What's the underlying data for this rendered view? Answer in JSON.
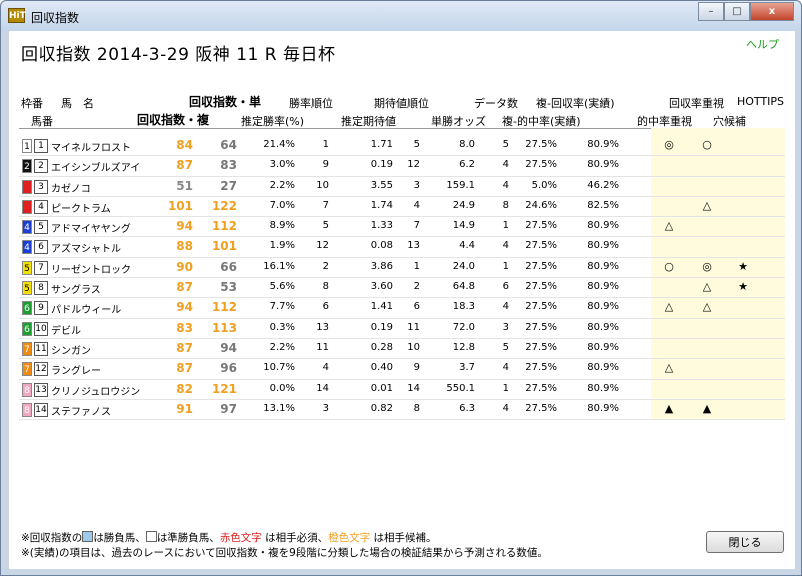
{
  "window": {
    "title": "回収指数",
    "app_icon_text": "HiT",
    "minimize": "–",
    "maximize": "□",
    "close": "x"
  },
  "page": {
    "help": "ヘルプ",
    "title": "回収指数  2014-3-29 阪神 11 R 毎日杯"
  },
  "headers": {
    "waku": "枠番",
    "uma": "馬　名",
    "umaban": "馬番",
    "index_single": "回収指数・単",
    "index_double": "回収指数・複",
    "win_rank": "勝率順位",
    "ev_rank": "期待値順位",
    "data_count": "データ数",
    "place_return": "複-回収率(実績)",
    "focus": "回収率重視",
    "hottips": "HOTTIPS",
    "est_win": "推定勝率(%)",
    "est_ev": "推定期待値",
    "win_odds": "単勝オッズ",
    "place_hit": "複-的中率(実績)",
    "hit_focus": "的中率重視",
    "dark_horse": "穴候補"
  },
  "colors": {
    "red": "#e02020",
    "orange": "#f0a020",
    "blue_cell": "#9fc9e8"
  },
  "rows": [
    {
      "waku": "1",
      "waku_bg": "#ffffff",
      "waku_fg": "#000",
      "uma": "1",
      "name": "マイネルフロスト",
      "i1": "84",
      "i1c": "#f0a020",
      "i2": "64",
      "wp": "21.4%",
      "wr": "1",
      "ev": "1.71",
      "er": "5",
      "odds": "8.0",
      "dc": "5",
      "hit": "27.5%",
      "ret": "80.9%",
      "m1": "◎",
      "m2": "○",
      "m3": ""
    },
    {
      "waku": "2",
      "waku_bg": "#111111",
      "waku_fg": "#fff",
      "uma": "2",
      "name": "エイシンブルズアイ",
      "i1": "87",
      "i1c": "#f0a020",
      "i2": "83",
      "wp": "3.0%",
      "wr": "9",
      "ev": "0.19",
      "er": "12",
      "odds": "6.2",
      "dc": "4",
      "hit": "27.5%",
      "ret": "80.9%",
      "m1": "",
      "m2": "",
      "m3": ""
    },
    {
      "waku": "3",
      "waku_bg": "#e02020",
      "waku_fg": "#e02020",
      "uma": "3",
      "name": "カゼノコ",
      "i1": "51",
      "i1c": "#888888",
      "i2": "27",
      "wp": "2.2%",
      "wr": "10",
      "ev": "3.55",
      "er": "3",
      "odds": "159.1",
      "dc": "4",
      "hit": "5.0%",
      "ret": "46.2%",
      "m1": "",
      "m2": "",
      "m3": ""
    },
    {
      "waku": "3",
      "waku_bg": "#e02020",
      "waku_fg": "#e02020",
      "uma": "4",
      "name": "ピークトラム",
      "i1": "101",
      "i1c": "#f0a020",
      "i2": "122",
      "i2c": "#f0a020",
      "wp": "7.0%",
      "wr": "7",
      "ev": "1.74",
      "er": "4",
      "odds": "24.9",
      "dc": "8",
      "hit": "24.6%",
      "ret": "82.5%",
      "m1": "",
      "m2": "△",
      "m3": ""
    },
    {
      "waku": "4",
      "waku_bg": "#1b3fd6",
      "waku_fg": "#fff",
      "uma": "5",
      "name": "アドマイヤヤング",
      "i1": "94",
      "i1c": "#f0a020",
      "i2": "112",
      "i2c": "#f0a020",
      "wp": "8.9%",
      "wr": "5",
      "ev": "1.33",
      "er": "7",
      "odds": "14.9",
      "dc": "1",
      "hit": "27.5%",
      "ret": "80.9%",
      "m1": "△",
      "m2": "",
      "m3": ""
    },
    {
      "waku": "4",
      "waku_bg": "#1b3fd6",
      "waku_fg": "#fff",
      "uma": "6",
      "name": "アズマシャトル",
      "i1": "88",
      "i1c": "#f0a020",
      "i2": "101",
      "i2c": "#f0a020",
      "wp": "1.9%",
      "wr": "12",
      "ev": "0.08",
      "er": "13",
      "odds": "4.4",
      "dc": "4",
      "hit": "27.5%",
      "ret": "80.9%",
      "m1": "",
      "m2": "",
      "m3": ""
    },
    {
      "waku": "5",
      "waku_bg": "#f4e000",
      "waku_fg": "#000",
      "uma": "7",
      "name": "リーゼントロック",
      "i1": "90",
      "i1c": "#f0a020",
      "i2": "66",
      "wp": "16.1%",
      "wr": "2",
      "ev": "3.86",
      "er": "1",
      "odds": "24.0",
      "dc": "1",
      "hit": "27.5%",
      "ret": "80.9%",
      "m1": "○",
      "m2": "◎",
      "m3": "★"
    },
    {
      "waku": "5",
      "waku_bg": "#f4e000",
      "waku_fg": "#000",
      "uma": "8",
      "name": "サングラス",
      "i1": "87",
      "i1c": "#f0a020",
      "i2": "53",
      "wp": "5.6%",
      "wr": "8",
      "ev": "3.60",
      "er": "2",
      "odds": "64.8",
      "dc": "6",
      "hit": "27.5%",
      "ret": "80.9%",
      "m1": "",
      "m2": "△",
      "m3": "★"
    },
    {
      "waku": "6",
      "waku_bg": "#1aa030",
      "waku_fg": "#fff",
      "uma": "9",
      "name": "パドルウィール",
      "i1": "94",
      "i1c": "#f0a020",
      "i2": "112",
      "i2c": "#f0a020",
      "wp": "7.7%",
      "wr": "6",
      "ev": "1.41",
      "er": "6",
      "odds": "18.3",
      "dc": "4",
      "hit": "27.5%",
      "ret": "80.9%",
      "m1": "△",
      "m2": "△",
      "m3": ""
    },
    {
      "waku": "6",
      "waku_bg": "#1aa030",
      "waku_fg": "#fff",
      "uma": "10",
      "name": "デビル",
      "i1": "83",
      "i1c": "#f0a020",
      "i2": "113",
      "i2c": "#f0a020",
      "wp": "0.3%",
      "wr": "13",
      "ev": "0.19",
      "er": "11",
      "odds": "72.0",
      "dc": "3",
      "hit": "27.5%",
      "ret": "80.9%",
      "m1": "",
      "m2": "",
      "m3": ""
    },
    {
      "waku": "7",
      "waku_bg": "#f08a10",
      "waku_fg": "#fff",
      "uma": "11",
      "name": "シンガン",
      "i1": "87",
      "i1c": "#f0a020",
      "i2": "94",
      "wp": "2.2%",
      "wr": "11",
      "ev": "0.28",
      "er": "10",
      "odds": "12.8",
      "dc": "5",
      "hit": "27.5%",
      "ret": "80.9%",
      "m1": "",
      "m2": "",
      "m3": ""
    },
    {
      "waku": "7",
      "waku_bg": "#f08a10",
      "waku_fg": "#fff",
      "uma": "12",
      "name": "ラングレー",
      "i1": "87",
      "i1c": "#f0a020",
      "i2": "96",
      "wp": "10.7%",
      "wr": "4",
      "ev": "0.40",
      "er": "9",
      "odds": "3.7",
      "dc": "4",
      "hit": "27.5%",
      "ret": "80.9%",
      "m1": "△",
      "m2": "",
      "m3": ""
    },
    {
      "waku": "8",
      "waku_bg": "#f4a8c0",
      "waku_fg": "#fff",
      "uma": "13",
      "name": "クリノジュロウジン",
      "i1": "82",
      "i1c": "#f0a020",
      "i2": "121",
      "i2c": "#f0a020",
      "wp": "0.0%",
      "wr": "14",
      "ev": "0.01",
      "er": "14",
      "odds": "550.1",
      "dc": "1",
      "hit": "27.5%",
      "ret": "80.9%",
      "m1": "",
      "m2": "",
      "m3": ""
    },
    {
      "waku": "8",
      "waku_bg": "#f4a8c0",
      "waku_fg": "#fff",
      "uma": "14",
      "name": "ステファノス",
      "i1": "91",
      "i1c": "#f0a020",
      "i2": "97",
      "wp": "13.1%",
      "wr": "3",
      "ev": "0.82",
      "er": "8",
      "odds": "6.3",
      "dc": "4",
      "hit": "27.5%",
      "ret": "80.9%",
      "m1": "▲",
      "m2": "▲",
      "m3": ""
    }
  ],
  "footer": {
    "line1_a": "※回収指数の",
    "line1_b": "は勝負馬、",
    "line1_c": "は準勝負馬、",
    "line1_red": "赤色文字",
    "line1_d": " は相手必須、",
    "line1_orange": "橙色文字",
    "line1_e": " は相手候補。",
    "line2": "※(実績)の項目は、過去のレースにおいて回収指数・複を9段階に分類した場合の検証結果から予測される数値。"
  },
  "close_button": "閉じる"
}
